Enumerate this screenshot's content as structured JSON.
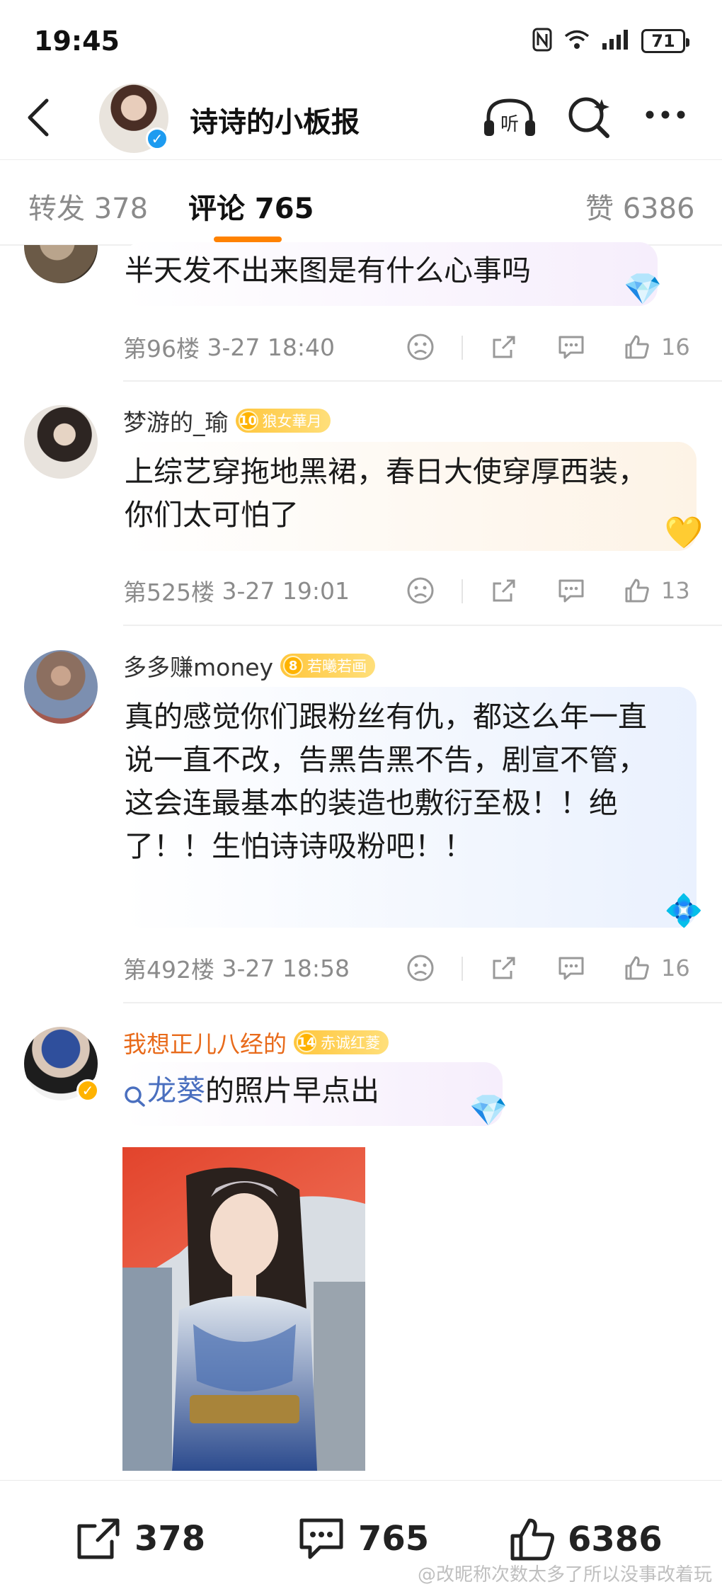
{
  "status_bar": {
    "time": "19:45",
    "battery": "71"
  },
  "header": {
    "title": "诗诗的小板报"
  },
  "tabs": {
    "repost": "转发 378",
    "comments": "评论 765",
    "likes": "赞 6386"
  },
  "comments": [
    {
      "text": "半天发不出来图是有什么心事吗",
      "floor": "第96楼",
      "time": "3-27 18:40",
      "likes": "16"
    },
    {
      "name": "梦游的_瑜",
      "badge_level": "10",
      "badge_text": "狼女華月",
      "text": "上综艺穿拖地黑裙，春日大使穿厚西装，你们太可怕了",
      "floor": "第525楼",
      "time": "3-27 19:01",
      "likes": "13"
    },
    {
      "name": "多多赚money",
      "badge_level": "8",
      "badge_text": "若曦若画",
      "text": "真的感觉你们跟粉丝有仇，都这么年一直说一直不改，告黑告黑不告，剧宣不管，这会连最基本的装造也敷衍至极！！绝了！！生怕诗诗吸粉吧！！",
      "floor": "第492楼",
      "time": "3-27 18:58",
      "likes": "16"
    },
    {
      "name": "我想正儿八经的",
      "badge_level": "14",
      "badge_text": "赤诚红菱",
      "search_link": "龙葵",
      "text": " 的照片早点出"
    }
  ],
  "bottom_bar": {
    "reposts": "378",
    "comments": "765",
    "likes": "6386"
  },
  "watermark": "@改昵称次数太多了所以没事改着玩",
  "colors": {
    "accent": "#ff8200",
    "link": "#4a6fbf",
    "verified": "#1d9bf0",
    "highlight_name": "#e86a1a",
    "meta_gray": "#8b8b8b"
  },
  "icons": [
    "back-icon",
    "listen-icon",
    "search-icon",
    "more-icon",
    "dislike-icon",
    "share-icon",
    "reply-icon",
    "like-icon"
  ]
}
